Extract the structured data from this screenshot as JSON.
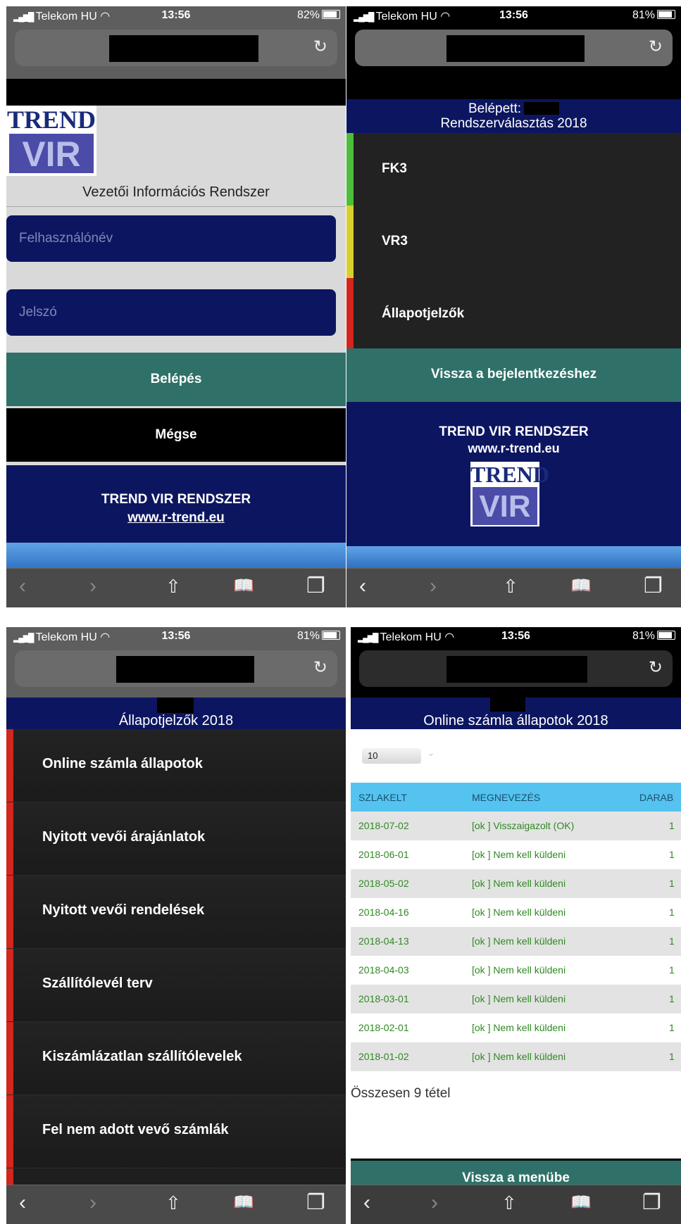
{
  "status": {
    "p1": {
      "carrier": "Telekom HU",
      "time": "13:56",
      "battery": "82%"
    },
    "p2": {
      "carrier": "Telekom HU",
      "time": "13:56",
      "battery": "81%"
    },
    "p3": {
      "carrier": "Telekom HU",
      "time": "13:56",
      "battery": "81%"
    },
    "p4": {
      "carrier": "Telekom HU",
      "time": "13:56",
      "battery": "81%"
    }
  },
  "login": {
    "logo_top": "TREND",
    "logo_bottom": "VIR",
    "subtitle": "Vezetői Információs Rendszer",
    "username_placeholder": "Felhasználónév",
    "password_placeholder": "Jelszó",
    "login_button": "Belépés",
    "cancel_button": "Mégse",
    "footer_title": "TREND VIR RENDSZER",
    "footer_link": "www.r-trend.eu"
  },
  "system_select": {
    "logged_in_label": "Belépett:",
    "title": "Rendszerválasztás 2018",
    "items": [
      {
        "label": "FK3",
        "color": "#4bbf3a"
      },
      {
        "label": "VR3",
        "color": "#d9cf30"
      },
      {
        "label": "Állapotjelzők",
        "color": "#d2261e"
      }
    ],
    "back_button": "Vissza a bejelentkezéshez",
    "footer_title": "TREND VIR RENDSZER",
    "footer_link": "www.r-trend.eu",
    "logo_top": "TREND",
    "logo_bottom": "VIR"
  },
  "indicators": {
    "title": "Állapotjelzők 2018",
    "accent": "#d2261e",
    "items": [
      "Online számla állapotok",
      "Nyitott vevői árajánlatok",
      "Nyitott vevői rendelések",
      "Szállítólevél terv",
      "Kiszámlázatlan szállítólevelek",
      "Fel nem adott vevő számlák"
    ]
  },
  "invoice_status": {
    "title": "Online számla állapotok 2018",
    "page_size": "10",
    "columns": [
      "SZLAKELT",
      "MEGNEVEZÉS",
      "DARAB"
    ],
    "rows": [
      [
        "2018-07-02",
        "[ok ] Visszaigazolt (OK)",
        "1"
      ],
      [
        "2018-06-01",
        "[ok ] Nem kell küldeni",
        "1"
      ],
      [
        "2018-05-02",
        "[ok ] Nem kell küldeni",
        "1"
      ],
      [
        "2018-04-16",
        "[ok ] Nem kell küldeni",
        "1"
      ],
      [
        "2018-04-13",
        "[ok ] Nem kell küldeni",
        "1"
      ],
      [
        "2018-04-03",
        "[ok ] Nem kell küldeni",
        "1"
      ],
      [
        "2018-03-01",
        "[ok ] Nem kell küldeni",
        "1"
      ],
      [
        "2018-02-01",
        "[ok ] Nem kell küldeni",
        "1"
      ],
      [
        "2018-01-02",
        "[ok ] Nem kell küldeni",
        "1"
      ]
    ],
    "total": "Összesen 9 tétel",
    "back_button": "Vissza a menübe"
  },
  "icons": {
    "back": "‹",
    "forward": "›",
    "share": "⇧",
    "bookmarks": "📖",
    "tabs": "❐",
    "reload": "↻",
    "wifi": "wifi-icon",
    "dropdown": "⌄"
  }
}
